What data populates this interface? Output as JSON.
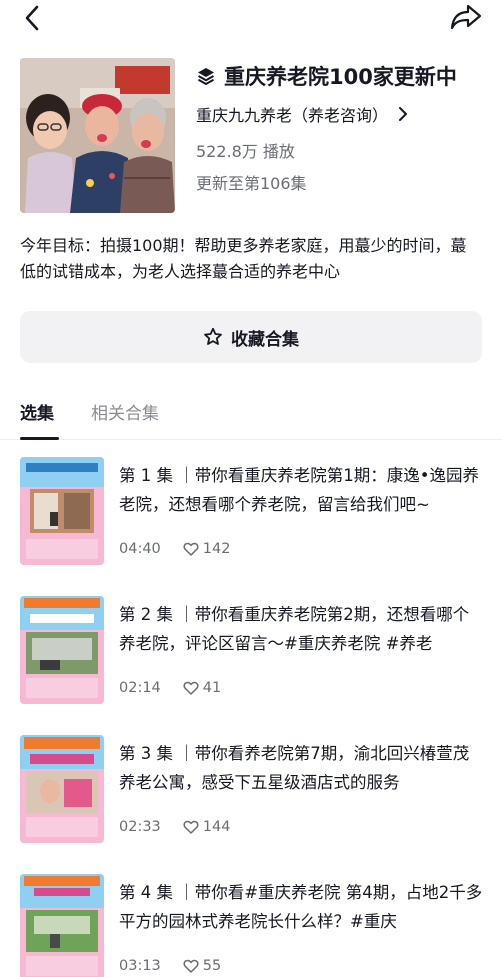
{
  "nav": {
    "back_icon": "chevron-left-icon",
    "share_icon": "share-arrow-icon"
  },
  "collection": {
    "title_icon": "stack-layers-icon",
    "title": "重庆养老院100家更新中",
    "author": "重庆九九养老（养老咨询）",
    "author_arrow_icon": "chevron-right-icon",
    "plays": "522.8万 播放",
    "updated": "更新至第106集",
    "description": "今年目标：拍摄100期！帮助更多养老家庭，用蕞少的时间，蕞低的试错成本，为老人选择蕞合适的养老中心"
  },
  "collect_button": {
    "icon": "star-outline-icon",
    "label": "收藏合集"
  },
  "tabs": {
    "selected": "选集",
    "related": "相关合集"
  },
  "episodes": [
    {
      "text": "第 1 集 ｜带你看重庆养老院第1期：康逸•逸园养老院，还想看哪个养老院，留言给我们吧~",
      "duration": "04:40",
      "likes": "142",
      "thumb_banner": "康逸养老院",
      "thumb_price": ""
    },
    {
      "text": "第 2 集 ｜带你看重庆养老院第2期，还想看哪个养老院，评论区留言～#重庆养老院 #养老",
      "duration": "02:14",
      "likes": "41",
      "thumb_banner": "尹氏养老中心",
      "thumb_price": "价格：2800-5800"
    },
    {
      "text": "第 3 集 ｜带你看养老院第7期，渝北回兴椿萱茂养老公寓，感受下五星级酒店式的服务",
      "duration": "02:33",
      "likes": "144",
      "thumb_banner": "椿萱茂养老公寓",
      "thumb_price": "5800-13000"
    },
    {
      "text": "第 4 集 ｜带你看#重庆养老院 第4期，占地2千多平方的园林式养老院长什么样？#重庆",
      "duration": "03:13",
      "likes": "55",
      "thumb_banner": "广仁园林老年公寓",
      "thumb_price": "价格：2600-5500"
    }
  ],
  "colors": {
    "text_primary": "#161823",
    "text_secondary": "#6b6d74",
    "button_bg": "#f2f2f4",
    "thumb_pink": "#f6b8d2",
    "thumb_sky": "#8fd0f2"
  }
}
